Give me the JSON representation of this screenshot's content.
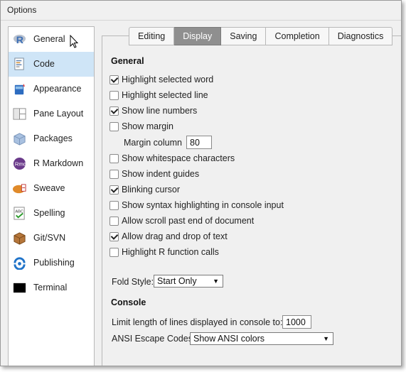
{
  "window": {
    "title": "Options"
  },
  "sidebar": {
    "items": [
      {
        "label": "General",
        "icon": "r-logo-icon",
        "selected": false
      },
      {
        "label": "Code",
        "icon": "code-document-icon",
        "selected": true
      },
      {
        "label": "Appearance",
        "icon": "paint-bucket-icon",
        "selected": false
      },
      {
        "label": "Pane Layout",
        "icon": "pane-layout-icon",
        "selected": false
      },
      {
        "label": "Packages",
        "icon": "package-box-icon",
        "selected": false
      },
      {
        "label": "R Markdown",
        "icon": "rmd-icon",
        "selected": false
      },
      {
        "label": "Sweave",
        "icon": "sweave-pdf-icon",
        "selected": false
      },
      {
        "label": "Spelling",
        "icon": "spellcheck-icon",
        "selected": false
      },
      {
        "label": "Git/SVN",
        "icon": "git-box-icon",
        "selected": false
      },
      {
        "label": "Publishing",
        "icon": "publishing-icon",
        "selected": false
      },
      {
        "label": "Terminal",
        "icon": "terminal-icon",
        "selected": false
      }
    ]
  },
  "tabs": [
    {
      "label": "Editing",
      "active": false
    },
    {
      "label": "Display",
      "active": true
    },
    {
      "label": "Saving",
      "active": false
    },
    {
      "label": "Completion",
      "active": false
    },
    {
      "label": "Diagnostics",
      "active": false
    }
  ],
  "general": {
    "heading": "General",
    "options": [
      {
        "label": "Highlight selected word",
        "checked": true
      },
      {
        "label": "Highlight selected line",
        "checked": false
      },
      {
        "label": "Show line numbers",
        "checked": true
      },
      {
        "label": "Show margin",
        "checked": false
      },
      {
        "label": "Show whitespace characters",
        "checked": false
      },
      {
        "label": "Show indent guides",
        "checked": false
      },
      {
        "label": "Blinking cursor",
        "checked": true
      },
      {
        "label": "Show syntax highlighting in console input",
        "checked": false
      },
      {
        "label": "Allow scroll past end of document",
        "checked": false
      },
      {
        "label": "Allow drag and drop of text",
        "checked": true
      },
      {
        "label": "Highlight R function calls",
        "checked": false
      }
    ],
    "margin_column_label": "Margin column",
    "margin_column_value": "80",
    "fold_style_label": "Fold Style:",
    "fold_style_value": "Start Only"
  },
  "console": {
    "heading": "Console",
    "limit_label": "Limit length of lines displayed in console to:",
    "limit_value": "1000",
    "ansi_label": "ANSI Escape Codes:",
    "ansi_value": "Show ANSI colors"
  },
  "colors": {
    "selected_item_bg": "#cfe5f7",
    "active_tab_bg": "#8f8f8f"
  }
}
